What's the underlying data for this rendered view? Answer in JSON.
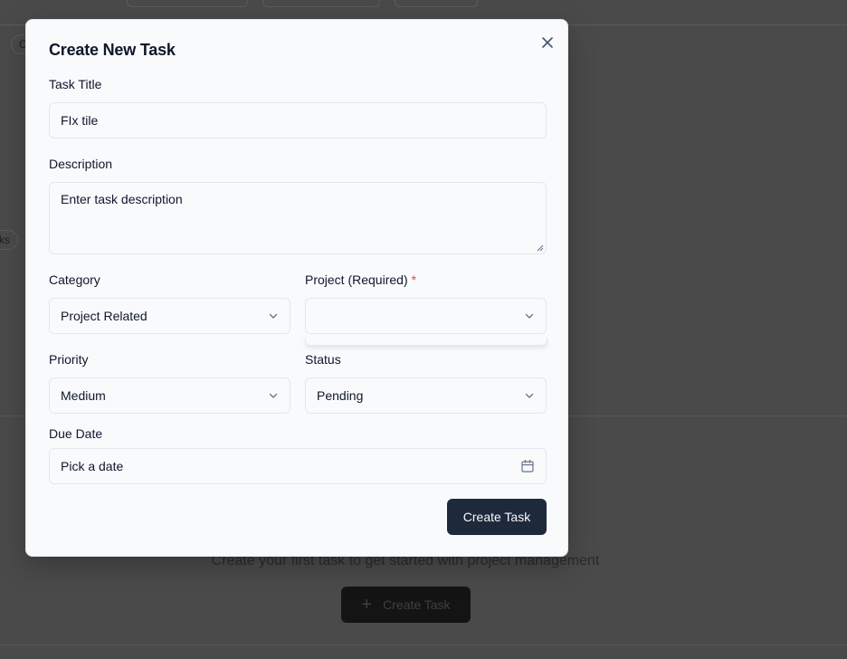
{
  "background": {
    "chip_left": "C",
    "chip_left2": "ks",
    "empty_state_text": "Create your first task to get started with project management",
    "create_button_label": "Create Task"
  },
  "modal": {
    "title": "Create New Task",
    "close_icon": "close-icon",
    "task_title": {
      "label": "Task Title",
      "value": "FIx tile"
    },
    "description": {
      "label": "Description",
      "placeholder": "Enter task description"
    },
    "category": {
      "label": "Category",
      "value": "Project Related"
    },
    "project": {
      "label": "Project (Required)",
      "required_mark": "*",
      "value": ""
    },
    "priority": {
      "label": "Priority",
      "value": "Medium"
    },
    "status": {
      "label": "Status",
      "value": "Pending"
    },
    "due_date": {
      "label": "Due Date",
      "placeholder": "Pick a date"
    },
    "submit_label": "Create Task"
  },
  "colors": {
    "primary": "#1e293b",
    "required": "#ef4444",
    "border": "#e2e8f0"
  }
}
